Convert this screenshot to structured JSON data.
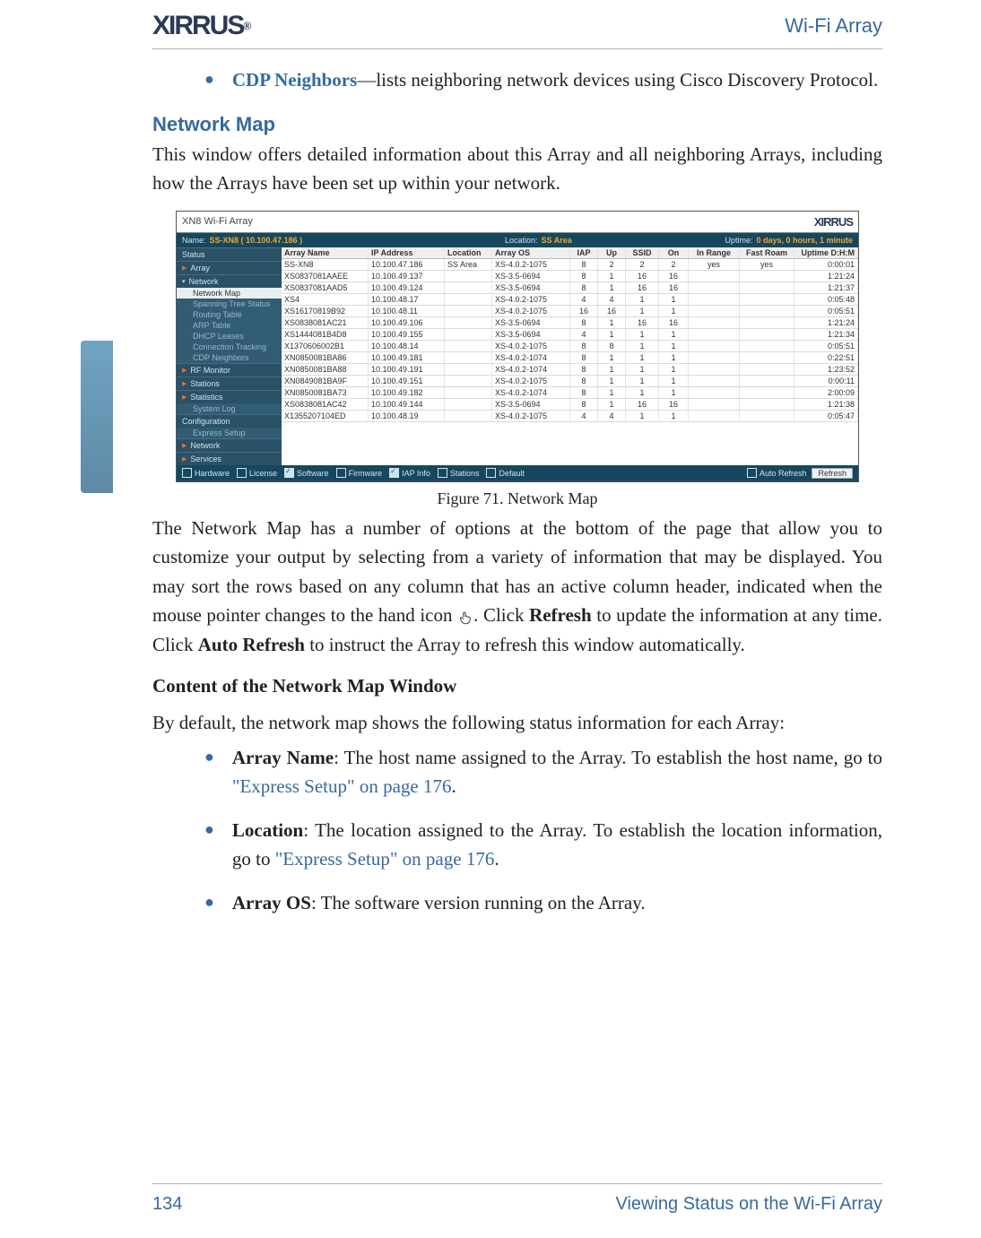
{
  "header": {
    "logo_text": "XIRRUS",
    "right": "Wi-Fi Array"
  },
  "intro_bullet": {
    "link": "CDP Neighbors",
    "dash": "—",
    "rest": "lists neighboring network devices using Cisco Discovery Protocol."
  },
  "section_heading": "Network Map",
  "section_para": "This window offers detailed information about this Array and all neighboring Arrays, including how the Arrays have been set up within your network.",
  "figure_caption": "Figure 71. Network Map",
  "para2_a": "The Network Map has a number of options at the bottom of the page that allow you to customize your output by selecting from a variety of information that may be displayed. You may sort the rows based on any column that has an active column header, indicated when the mouse pointer changes to the hand icon ",
  "para2_b": ". Click ",
  "para2_refresh": "Refresh",
  "para2_c": " to update the information at any time. Click ",
  "para2_auto": "Auto Refresh",
  "para2_d": " to instruct the Array to refresh this window automatically.",
  "subhead": "Content of the Network Map Window",
  "para3": "By default, the network map shows the following status information for each Array:",
  "bullets": [
    {
      "term": "Array Name",
      "text": ": The host name assigned to the Array. To establish the host name, go to ",
      "xref": "\"Express Setup\" on page 176",
      "tail": "."
    },
    {
      "term": "Location",
      "text": ": The location assigned to the Array. To establish the location information, go to ",
      "xref": "\"Express Setup\" on page 176",
      "tail": "."
    },
    {
      "term": "Array OS",
      "text": ": The software version running on the Array.",
      "xref": "",
      "tail": ""
    }
  ],
  "footer": {
    "page": "134",
    "section": "Viewing Status on the Wi-Fi Array"
  },
  "shot": {
    "top_title": "XN8 Wi-Fi Array",
    "brand": "XIRRUS",
    "bar": {
      "name_label": "Name:",
      "name_value": "SS-XN8  ( 10.100.47.186 )",
      "loc_label": "Location:",
      "loc_value": "SS Area",
      "uptime_label": "Uptime:",
      "uptime_value": "0 days, 0 hours, 1 minute"
    },
    "nav": {
      "status": "Status",
      "array": "Array",
      "network": "Network",
      "items": [
        "Network Map",
        "Spanning Tree Status",
        "Routing Table",
        "ARP Table",
        "DHCP Leases",
        "Connection Tracking",
        "CDP Neighbors"
      ],
      "rf": "RF Monitor",
      "stations": "Stations",
      "stats": "Statistics",
      "syslog": "System Log",
      "config": "Configuration",
      "express": "Express Setup",
      "netgrp": "Network",
      "services": "Services"
    },
    "cols": [
      "Array Name",
      "IP Address",
      "Location",
      "Array OS",
      "IAP",
      "Up",
      "SSID",
      "On",
      "In Range",
      "Fast Roam",
      "Uptime D:H:M"
    ],
    "rows": [
      [
        "SS-XN8",
        "10.100.47.186",
        "SS Area",
        "XS-4.0.2-1075",
        "8",
        "2",
        "2",
        "2",
        "yes",
        "yes",
        "0:00:01"
      ],
      [
        "XS0837081AAEE",
        "10.100.49.137",
        "",
        "XS-3.5-0694",
        "8",
        "1",
        "16",
        "16",
        "",
        "",
        "1:21:24"
      ],
      [
        "XS0837081AAD5",
        "10.100.49.124",
        "",
        "XS-3.5-0694",
        "8",
        "1",
        "16",
        "16",
        "",
        "",
        "1:21:37"
      ],
      [
        "XS4",
        "10.100.48.17",
        "",
        "XS-4.0.2-1075",
        "4",
        "4",
        "1",
        "1",
        "",
        "",
        "0:05:48"
      ],
      [
        "XS16170819B92",
        "10.100.48.11",
        "",
        "XS-4.0.2-1075",
        "16",
        "16",
        "1",
        "1",
        "",
        "",
        "0:05:51"
      ],
      [
        "XS0838081AC21",
        "10.100.49.106",
        "",
        "XS-3.5-0694",
        "8",
        "1",
        "16",
        "16",
        "",
        "",
        "1:21:24"
      ],
      [
        "XS1444081B4D8",
        "10.100.49.155",
        "",
        "XS-3.5-0694",
        "4",
        "1",
        "1",
        "1",
        "",
        "",
        "1:21:34"
      ],
      [
        "X1370606002B1",
        "10.100.48.14",
        "",
        "XS-4.0.2-1075",
        "8",
        "8",
        "1",
        "1",
        "",
        "",
        "0:05:51"
      ],
      [
        "XN0850081BA86",
        "10.100.49.181",
        "",
        "XS-4.0.2-1074",
        "8",
        "1",
        "1",
        "1",
        "",
        "",
        "0:22:51"
      ],
      [
        "XN0850081BA88",
        "10.100.49.191",
        "",
        "XS-4.0.2-1074",
        "8",
        "1",
        "1",
        "1",
        "",
        "",
        "1:23:52"
      ],
      [
        "XN0849081BA9F",
        "10.100.49.151",
        "",
        "XS-4.0.2-1075",
        "8",
        "1",
        "1",
        "1",
        "",
        "",
        "0:00:11"
      ],
      [
        "XN0850081BA73",
        "10.100.49.182",
        "",
        "XS-4.0.2-1074",
        "8",
        "1",
        "1",
        "1",
        "",
        "",
        "2:00:09"
      ],
      [
        "XS0838081AC42",
        "10.100.49.144",
        "",
        "XS-3.5-0694",
        "8",
        "1",
        "16",
        "16",
        "",
        "",
        "1:21:38"
      ],
      [
        "X1355207104ED",
        "10.100.48.19",
        "",
        "XS-4.0.2-1075",
        "4",
        "4",
        "1",
        "1",
        "",
        "",
        "0:05:47"
      ]
    ],
    "foot_checks": [
      {
        "label": "Hardware",
        "on": false
      },
      {
        "label": "License",
        "on": false
      },
      {
        "label": "Software",
        "on": true
      },
      {
        "label": "Firmware",
        "on": false
      },
      {
        "label": "IAP Info",
        "on": true
      },
      {
        "label": "Stations",
        "on": false
      },
      {
        "label": "Default",
        "on": false
      }
    ],
    "auto_refresh_label": "Auto Refresh",
    "refresh_btn": "Refresh"
  }
}
